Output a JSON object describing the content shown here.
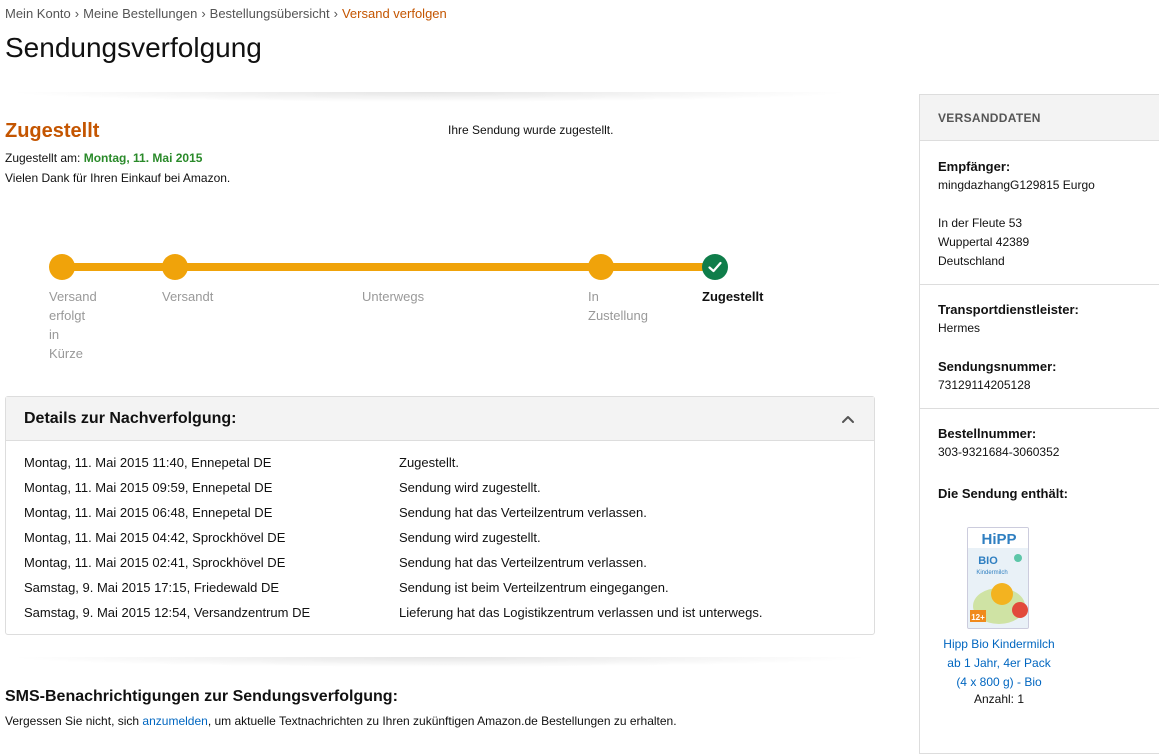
{
  "breadcrumb": {
    "items": [
      "Mein Konto",
      "Meine Bestellungen",
      "Bestellungsübersicht",
      "Versand verfolgen"
    ],
    "separator": "›"
  },
  "page": {
    "title": "Sendungsverfolgung"
  },
  "status": {
    "title": "Zugestellt",
    "message": "Ihre Sendung wurde zugestellt.",
    "delivered_label": "Zugestellt am:",
    "delivered_date": "Montag, 11. Mai 2015",
    "thanks": "Vielen Dank für Ihren Einkauf bei Amazon."
  },
  "tracker": {
    "steps": [
      {
        "label": "Versand erfolgt in Kürze",
        "lines": [
          "Versand",
          "erfolgt",
          "in",
          "Kürze"
        ]
      },
      {
        "label": "Versandt",
        "lines": [
          "Versandt"
        ]
      },
      {
        "label": "Unterwegs",
        "lines": [
          "Unterwegs"
        ]
      },
      {
        "label": "In Zustellung",
        "lines": [
          "In",
          "Zustellung"
        ]
      },
      {
        "label": "Zugestellt",
        "lines": [
          "Zugestellt"
        ]
      }
    ],
    "current_step": 4,
    "accent_color": "#f0a30a",
    "done_color": "#0f7d4a"
  },
  "details": {
    "title": "Details zur Nachverfolgung:",
    "events": [
      {
        "time": "Montag, 11. Mai 2015 11:40, Ennepetal DE",
        "desc": "Zugestellt."
      },
      {
        "time": "Montag, 11. Mai 2015 09:59, Ennepetal DE",
        "desc": "Sendung wird zugestellt."
      },
      {
        "time": "Montag, 11. Mai 2015 06:48, Ennepetal DE",
        "desc": "Sendung hat das Verteilzentrum verlassen."
      },
      {
        "time": "Montag, 11. Mai 2015 04:42, Sprockhövel DE",
        "desc": "Sendung wird zugestellt."
      },
      {
        "time": "Montag, 11. Mai 2015 02:41, Sprockhövel DE",
        "desc": "Sendung hat das Verteilzentrum verlassen."
      },
      {
        "time": "Samstag, 9. Mai 2015 17:15, Friedewald DE",
        "desc": "Sendung ist beim Verteilzentrum eingegangen."
      },
      {
        "time": "Samstag, 9. Mai 2015 12:54, Versandzentrum DE",
        "desc": "Lieferung hat das Logistikzentrum verlassen und ist unterwegs."
      }
    ]
  },
  "sms": {
    "title": "SMS-Benachrichtigungen zur Sendungsverfolgung:",
    "text_before": "Vergessen Sie nicht, sich ",
    "link": "anzumelden",
    "text_after": ", um aktuelle Textnachrichten zu Ihren zukünftigen Amazon.de Bestellungen zu erhalten."
  },
  "sidebar": {
    "header": "VERSANDDATEN",
    "recipient_label": "Empfänger:",
    "recipient_name": "mingdazhangG129815 Eurgo",
    "address_line1": "In der Fleute 53",
    "address_line2": "Wuppertal 42389",
    "address_line3": "Deutschland",
    "carrier_label": "Transportdienstleister:",
    "carrier": "Hermes",
    "tracking_label": "Sendungsnummer:",
    "tracking_number": "73129114205128",
    "order_label": "Bestellnummer:",
    "order_number": "303-9321684-3060352",
    "contents_label": "Die Sendung enthält:",
    "product": {
      "name_lines": [
        "Hipp Bio Kindermilch",
        "ab 1 Jahr, 4er Pack",
        "(4 x 800 g) - Bio"
      ],
      "name": "Hipp Bio Kindermilch ab 1 Jahr, 4er Pack (4 x 800 g) - Bio",
      "quantity": "Anzahl: 1",
      "image_text_brand": "HiPP",
      "image_text_bio": "BIO",
      "image_text_sub": "Kindermilch",
      "image_text_age": "12+"
    }
  }
}
